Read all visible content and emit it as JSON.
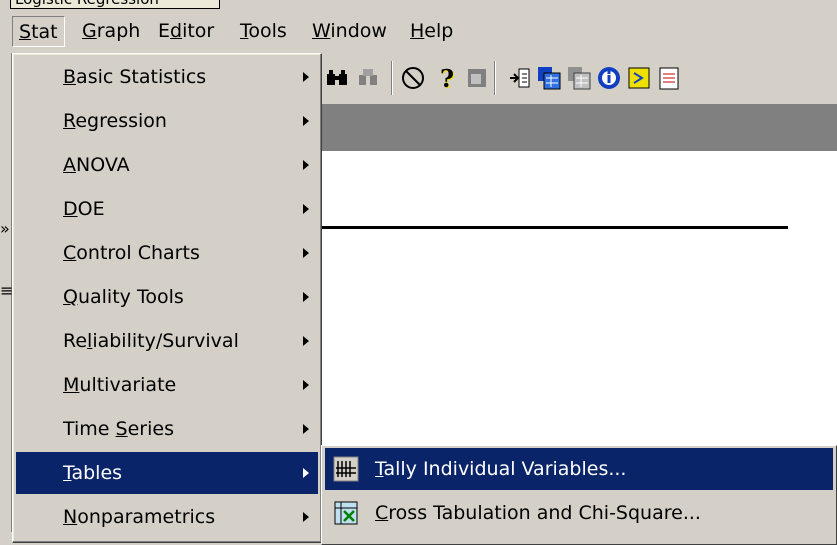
{
  "window": {
    "title": "Logistic Regression"
  },
  "menubar": {
    "items": [
      {
        "label": "Stat",
        "mnemonic": "S"
      },
      {
        "label": "Graph",
        "mnemonic": "G"
      },
      {
        "label": "Editor",
        "mnemonic": "i"
      },
      {
        "label": "Tools",
        "mnemonic": "T"
      },
      {
        "label": "Window",
        "mnemonic": "W"
      },
      {
        "label": "Help",
        "mnemonic": "H"
      }
    ]
  },
  "stat_menu": {
    "items": [
      {
        "label": "Basic Statistics"
      },
      {
        "label": "Regression"
      },
      {
        "label": "ANOVA"
      },
      {
        "label": "DOE"
      },
      {
        "label": "Control Charts"
      },
      {
        "label": "Quality Tools"
      },
      {
        "label": "Reliability/Survival"
      },
      {
        "label": "Multivariate"
      },
      {
        "label": "Time Series"
      },
      {
        "label": "Tables",
        "selected": true
      },
      {
        "label": "Nonparametrics"
      }
    ]
  },
  "tables_submenu": {
    "items": [
      {
        "label": "Tally Individual Variables...",
        "icon": "tally-icon",
        "selected": true
      },
      {
        "label": "Cross Tabulation and Chi-Square...",
        "icon": "cross-tab-icon"
      }
    ]
  },
  "toolbar": {
    "icons": [
      "binoculars-icon",
      "find-icon",
      "cancel-icon",
      "help-icon",
      "session-icon",
      "insert-icon",
      "worksheet-icon",
      "worksheet2-icon",
      "info-icon",
      "history-icon",
      "notepad-icon"
    ]
  },
  "colors": {
    "highlight": "#0a246a",
    "face": "#d4d0c8",
    "shadow": "#808080"
  }
}
